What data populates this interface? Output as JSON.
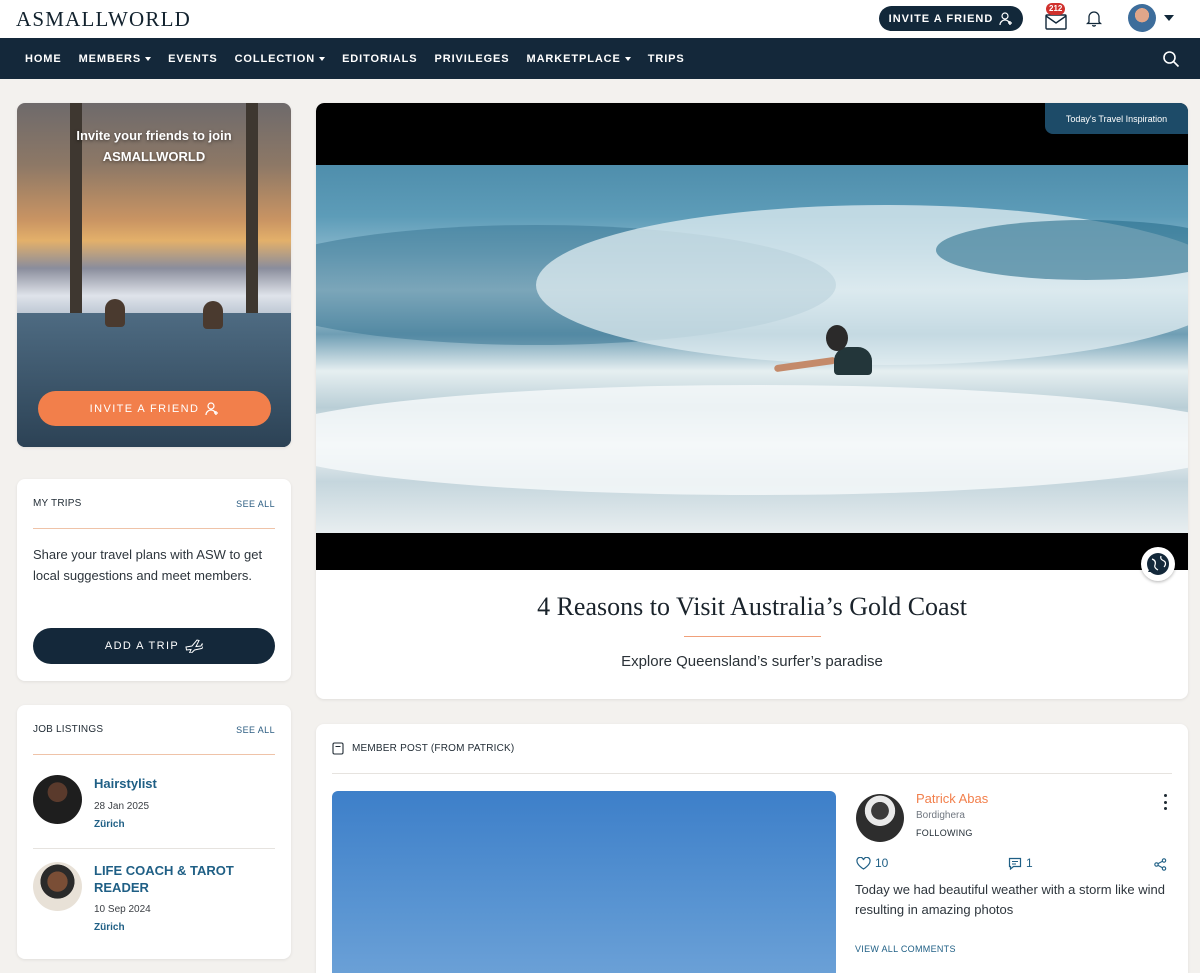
{
  "brand": {
    "logo": "ASMALLWORLD"
  },
  "header": {
    "invite_label": "INVITE A FRIEND",
    "mail_count": "212"
  },
  "nav": {
    "items": [
      {
        "label": "HOME",
        "dropdown": false
      },
      {
        "label": "MEMBERS",
        "dropdown": true
      },
      {
        "label": "EVENTS",
        "dropdown": false
      },
      {
        "label": "COLLECTION",
        "dropdown": true
      },
      {
        "label": "EDITORIALS",
        "dropdown": false
      },
      {
        "label": "PRIVILEGES",
        "dropdown": false
      },
      {
        "label": "MARKETPLACE",
        "dropdown": true
      },
      {
        "label": "TRIPS",
        "dropdown": false
      }
    ]
  },
  "promo": {
    "text_line1": "Invite your friends to join",
    "text_line2": "ASMALLWORLD",
    "button": "INVITE A FRIEND"
  },
  "trips": {
    "title": "MY TRIPS",
    "see_all": "SEE ALL",
    "text": "Share your travel plans with ASW to get local suggestions and meet members.",
    "button": "ADD A TRIP"
  },
  "jobs": {
    "title": "JOB LISTINGS",
    "see_all": "SEE ALL",
    "items": [
      {
        "title": "Hairstylist",
        "date": "28 Jan 2025",
        "location": "Zürich"
      },
      {
        "title": "LIFE COACH & TAROT READER",
        "date": "10 Sep 2024",
        "location": "Zürich"
      }
    ]
  },
  "hero": {
    "badge": "Today's Travel Inspiration",
    "title": "4 Reasons to Visit Australia’s Gold Coast",
    "subtitle": "Explore Queensland’s surfer’s paradise"
  },
  "post": {
    "label": "MEMBER POST (FROM PATRICK)",
    "author": "Patrick Abas",
    "location": "Bordighera",
    "follow_status": "FOLLOWING",
    "likes": "10",
    "comments": "1",
    "text": "Today we had beautiful weather with a storm like wind resulting in amazing photos",
    "view_comments": "VIEW ALL COMMENTS"
  },
  "colors": {
    "navy": "#14283a",
    "accent_orange": "#f27f4b",
    "link_blue": "#1f5f85",
    "background": "#f3f1ee"
  },
  "icons": [
    "person-add-icon",
    "mail-icon",
    "bell-icon",
    "avatar",
    "search-icon",
    "plane-icon",
    "globe-icon",
    "bookmark-icon",
    "heart-icon",
    "comment-icon",
    "share-icon",
    "more-vertical-icon"
  ]
}
